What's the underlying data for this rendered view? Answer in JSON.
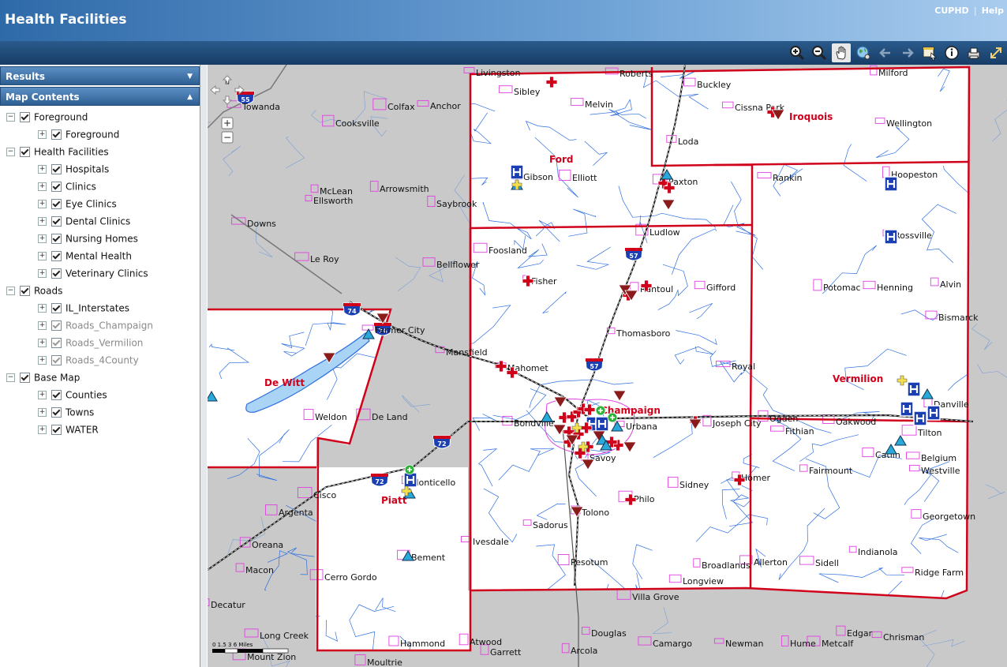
{
  "app": {
    "title": "Health Facilities"
  },
  "header_links": {
    "cuphd": "CUPHD",
    "separator": "|",
    "help": "Help"
  },
  "toolbar": {
    "tools": [
      {
        "name": "zoom-in-icon",
        "active": false
      },
      {
        "name": "zoom-out-icon",
        "active": false
      },
      {
        "name": "pan-hand-icon",
        "active": true
      },
      {
        "name": "full-extent-globe-icon",
        "active": false
      },
      {
        "name": "previous-extent-icon",
        "active": false
      },
      {
        "name": "next-extent-icon",
        "active": false
      },
      {
        "name": "select-features-icon",
        "active": false
      },
      {
        "name": "identify-info-icon",
        "active": false
      },
      {
        "name": "print-icon",
        "active": false
      },
      {
        "name": "expand-icon",
        "active": false
      }
    ]
  },
  "panels": {
    "results": "Results",
    "contents": "Map Contents"
  },
  "layers": [
    {
      "label": "Foreground",
      "level": 0,
      "dim": false
    },
    {
      "label": "Foreground",
      "level": 1,
      "dim": false
    },
    {
      "label": "Health Facilities",
      "level": 0,
      "dim": false
    },
    {
      "label": "Hospitals",
      "level": 1,
      "dim": false
    },
    {
      "label": "Clinics",
      "level": 1,
      "dim": false
    },
    {
      "label": "Eye Clinics",
      "level": 1,
      "dim": false
    },
    {
      "label": "Dental Clinics",
      "level": 1,
      "dim": false
    },
    {
      "label": "Nursing Homes",
      "level": 1,
      "dim": false
    },
    {
      "label": "Mental Health",
      "level": 1,
      "dim": false
    },
    {
      "label": "Veterinary Clinics",
      "level": 1,
      "dim": false
    },
    {
      "label": "Roads",
      "level": 0,
      "dim": false
    },
    {
      "label": "IL_Interstates",
      "level": 1,
      "dim": false
    },
    {
      "label": "Roads_Champaign",
      "level": 1,
      "dim": true
    },
    {
      "label": "Roads_Vermilion",
      "level": 1,
      "dim": true
    },
    {
      "label": "Roads_4County",
      "level": 1,
      "dim": true
    },
    {
      "label": "Base Map",
      "level": 0,
      "dim": false
    },
    {
      "label": "Counties",
      "level": 1,
      "dim": false
    },
    {
      "label": "Towns",
      "level": 1,
      "dim": false
    },
    {
      "label": "WATER",
      "level": 1,
      "dim": false
    }
  ],
  "map": {
    "colors": {
      "outside": "#c9c9c9",
      "inside": "#ffffff",
      "county_border": "#d0021b",
      "water": "#2d6fe0",
      "town": "#e040e0",
      "interstate": "#1a3fb3",
      "county_label": "#d0021b"
    },
    "towns": [
      "Livingston",
      "Roberts",
      "Buckley",
      "Milford",
      "Sibley",
      "Melvin",
      "Cissna Park",
      "Wellington",
      "Iroquois",
      "Loda",
      "Gibson",
      "Elliott",
      "Paxton",
      "Rankin",
      "Hoopeston",
      "Ford",
      "Ludlow",
      "Rossville",
      "Foosland",
      "Fisher",
      "Rantoul",
      "Gifford",
      "Potomac",
      "Henning",
      "Alvin",
      "Bismarck",
      "Thomasboro",
      "Mansfield",
      "Mahomet",
      "Royal",
      "Vermilion",
      "Danville",
      "Champaign",
      "Urbana",
      "Bondville",
      "Joseph City",
      "Ogden",
      "Fithian",
      "Oakwood",
      "Tilton",
      "Catlin",
      "Belgium",
      "Westville",
      "Savoy",
      "Fairmount",
      "Homer",
      "Sidney",
      "Philo",
      "Tolono",
      "Sadorus",
      "Georgetown",
      "Ivesdale",
      "Pesotum",
      "Broadlands",
      "Allerton",
      "Sidell",
      "Indianola",
      "Ridge Farm",
      "Longview",
      "Villa Grove",
      "Newman",
      "Hume",
      "Metcalf",
      "Edgar",
      "Chrisman",
      "Douglas",
      "Camargo",
      "Arcola",
      "Atwood",
      "Garrett",
      "Hammond",
      "Moultrie",
      "Cerro Gordo",
      "Bement",
      "Monticello",
      "Piatt",
      "De Land",
      "Weldon",
      "De Witt",
      "Farmer City",
      "Le Roy",
      "Bellflower",
      "Saybrook",
      "Arrowsmith",
      "Ellsworth",
      "McLean",
      "Downs",
      "Cooksville",
      "Colfax",
      "Anchor",
      "Towanda",
      "Argenta",
      "Oreana",
      "Macon",
      "Decatur",
      "Long Creek",
      "Mount Zion",
      "Cisco"
    ],
    "scale_text": "0 1.5 3 6 Miles",
    "nav": {
      "zoom_in": "+",
      "zoom_out": "−",
      "north": "N"
    }
  }
}
